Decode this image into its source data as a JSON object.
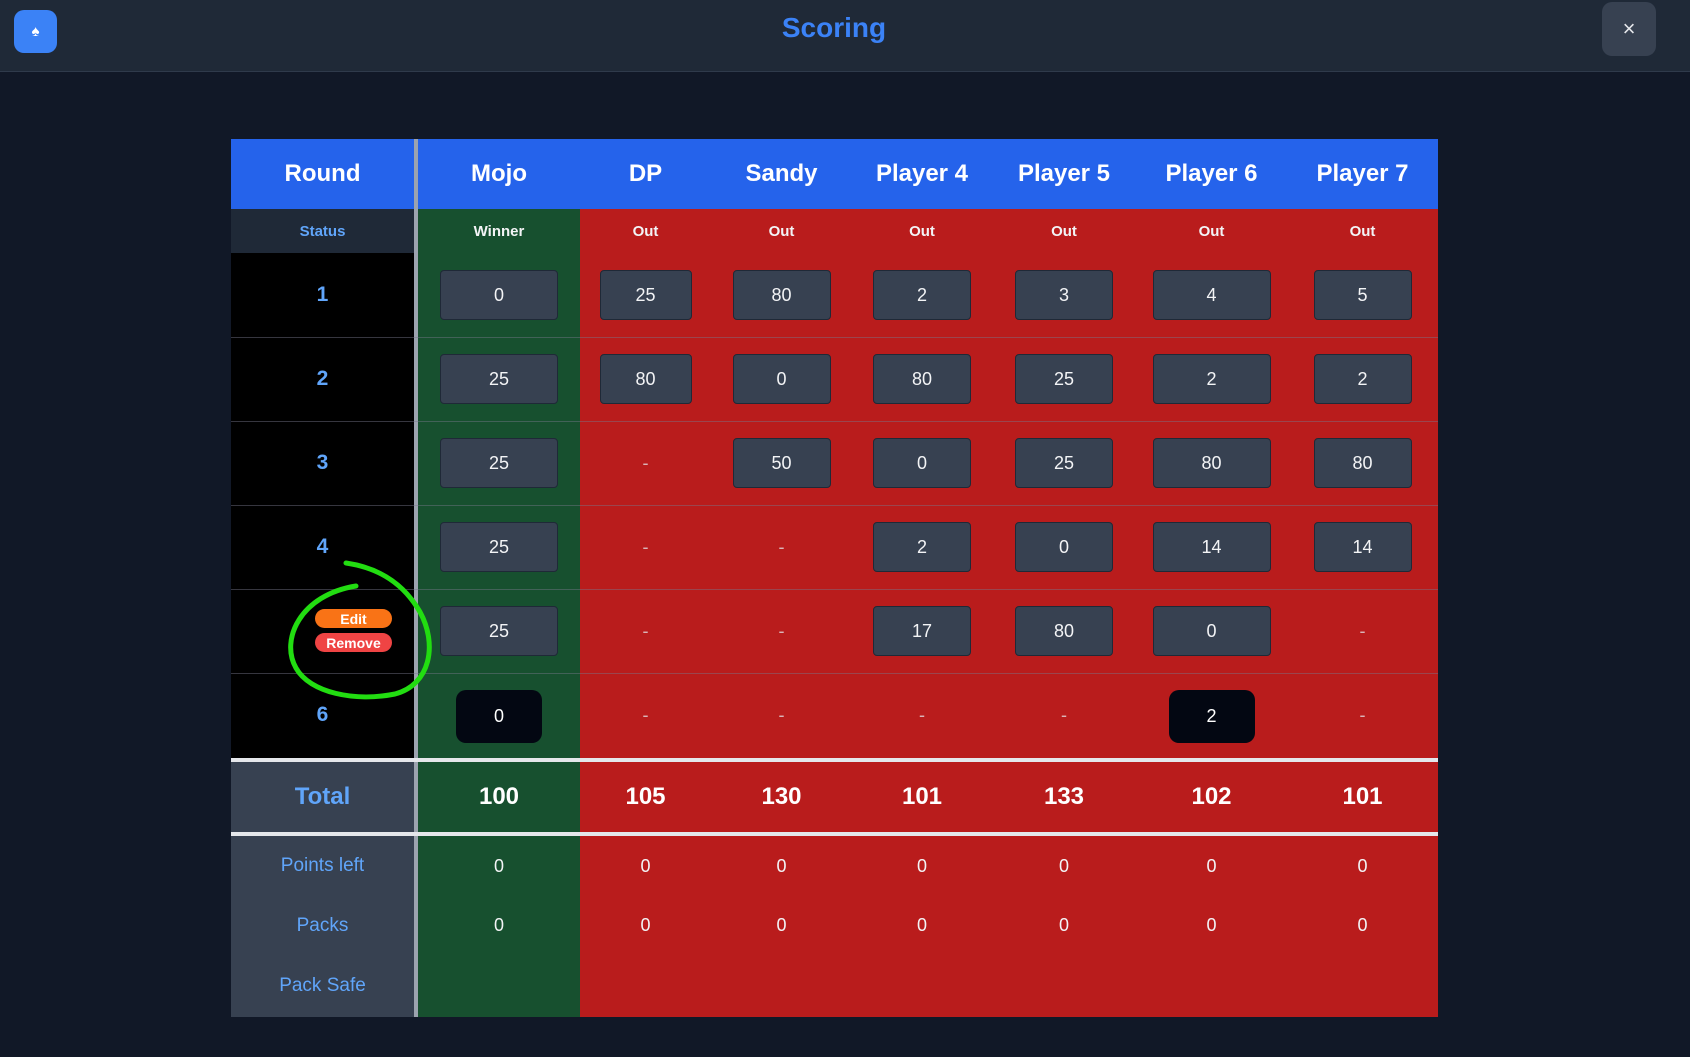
{
  "header": {
    "title": "Scoring",
    "close_label": "×",
    "app_icon": "spade-icon"
  },
  "table": {
    "round_header": "Round",
    "status_label": "Status",
    "players": [
      {
        "name": "Mojo",
        "status": "Winner"
      },
      {
        "name": "DP",
        "status": "Out"
      },
      {
        "name": "Sandy",
        "status": "Out"
      },
      {
        "name": "Player 4",
        "status": "Out"
      },
      {
        "name": "Player 5",
        "status": "Out"
      },
      {
        "name": "Player 6",
        "status": "Out"
      },
      {
        "name": "Player 7",
        "status": "Out"
      }
    ],
    "rounds": [
      {
        "label": "1",
        "scores": [
          "0",
          "25",
          "80",
          "2",
          "3",
          "4",
          "5"
        ]
      },
      {
        "label": "2",
        "scores": [
          "25",
          "80",
          "0",
          "80",
          "25",
          "2",
          "2"
        ]
      },
      {
        "label": "3",
        "scores": [
          "25",
          "-",
          "50",
          "0",
          "25",
          "80",
          "80"
        ]
      },
      {
        "label": "4",
        "scores": [
          "25",
          "-",
          "-",
          "2",
          "0",
          "14",
          "14"
        ]
      },
      {
        "label": "",
        "scores": [
          "25",
          "-",
          "-",
          "17",
          "80",
          "0",
          "-"
        ]
      },
      {
        "label": "6",
        "scores": [
          "0",
          "-",
          "-",
          "-",
          "-",
          "2",
          "-"
        ]
      }
    ],
    "total_label": "Total",
    "totals": [
      "100",
      "105",
      "130",
      "101",
      "133",
      "102",
      "101"
    ],
    "points_left_label": "Points left",
    "points_left": [
      "0",
      "0",
      "0",
      "0",
      "0",
      "0",
      "0"
    ],
    "packs_label": "Packs",
    "packs": [
      "0",
      "0",
      "0",
      "0",
      "0",
      "0",
      "0"
    ],
    "pack_safe_label": "Pack Safe"
  },
  "row_actions": {
    "edit_label": "Edit",
    "remove_label": "Remove"
  },
  "colors": {
    "header_blue": "#2563eb",
    "winner_green": "#17502f",
    "out_red": "#b91c1c",
    "annotation_green": "#22dd11"
  }
}
